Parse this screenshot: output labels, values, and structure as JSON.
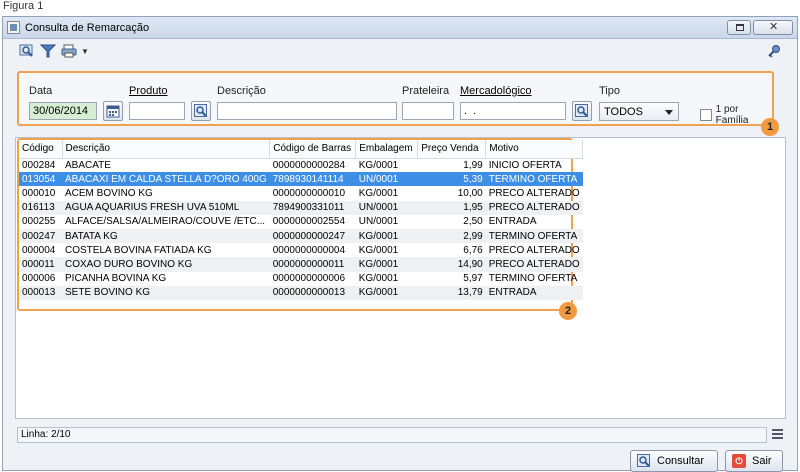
{
  "figure": {
    "caption": "Figura 1"
  },
  "window": {
    "title": "Consulta de Remarcação"
  },
  "filters": {
    "data": {
      "label": "Data",
      "value": "30/06/2014"
    },
    "produto": {
      "label": "Produto",
      "value": ""
    },
    "descricao": {
      "label": "Descrição",
      "value": ""
    },
    "prateleira": {
      "label": "Prateleira",
      "value": ""
    },
    "mercadologico": {
      "label": "Mercadológico",
      "value": ".  ."
    },
    "tipo": {
      "label": "Tipo",
      "value": "TODOS"
    },
    "por_familia": {
      "label": "1 por Família",
      "checked": false
    }
  },
  "badges": {
    "filters": "1",
    "grid": "2"
  },
  "grid": {
    "columns": [
      "Código",
      "Descrição",
      "Código de Barras",
      "Embalagem",
      "Preço Venda",
      "Motivo"
    ],
    "selected_index": 1,
    "rows": [
      [
        "000284",
        "ABACATE",
        "0000000000284",
        "KG/0001",
        "1,99",
        "INICIO OFERTA"
      ],
      [
        "013054",
        "ABACAXI EM CALDA STELLA D?ORO 400G",
        "7898930141114",
        "UN/0001",
        "5,39",
        "TERMINO OFERTA"
      ],
      [
        "000010",
        "ACEM BOVINO KG",
        "0000000000010",
        "KG/0001",
        "10,00",
        "PRECO ALTERADO"
      ],
      [
        "016113",
        "AGUA AQUARIUS FRESH UVA 510ML",
        "7894900331011",
        "UN/0001",
        "1,95",
        "PRECO ALTERADO"
      ],
      [
        "000255",
        "ALFACE/SALSA/ALMEIRAO/COUVE /ETC...",
        "0000000002554",
        "UN/0001",
        "2,50",
        "ENTRADA"
      ],
      [
        "000247",
        "BATATA KG",
        "0000000000247",
        "KG/0001",
        "2,99",
        "TERMINO OFERTA"
      ],
      [
        "000004",
        "COSTELA BOVINA FATIADA KG",
        "0000000000004",
        "KG/0001",
        "6,76",
        "PRECO ALTERADO"
      ],
      [
        "000011",
        "COXAO DURO BOVINO KG",
        "0000000000011",
        "KG/0001",
        "14,90",
        "PRECO ALTERADO"
      ],
      [
        "000006",
        "PICANHA BOVINA KG",
        "0000000000006",
        "KG/0001",
        "5,97",
        "TERMINO OFERTA"
      ],
      [
        "000013",
        "SETE BOVINO KG",
        "0000000000013",
        "KG/0001",
        "13,79",
        "ENTRADA"
      ]
    ]
  },
  "status": {
    "linha": "Linha: 2/10"
  },
  "actions": {
    "consultar": "Consultar",
    "sair": "Sair"
  },
  "colors": {
    "accent": "#f0a050",
    "selection": "#3d8ee6",
    "date_bg": "#d6efd2",
    "sair": "#e24c3a"
  }
}
